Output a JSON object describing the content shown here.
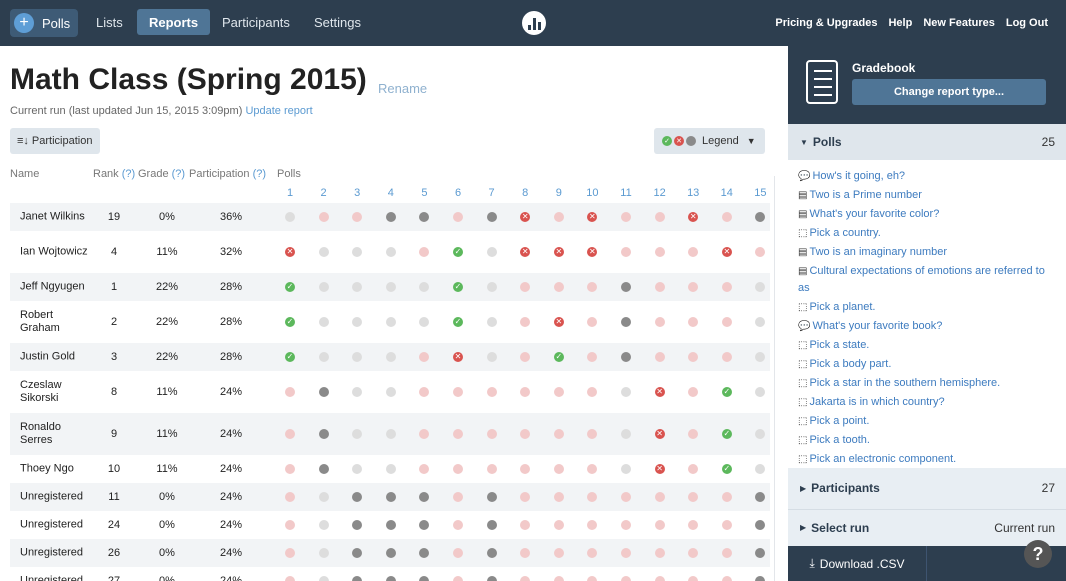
{
  "nav": {
    "polls": "Polls",
    "lists": "Lists",
    "reports": "Reports",
    "participants": "Participants",
    "settings": "Settings",
    "pricing": "Pricing & Upgrades",
    "help": "Help",
    "features": "New Features",
    "logout": "Log Out"
  },
  "page": {
    "title": "Math Class (Spring 2015)",
    "rename": "Rename",
    "subline": "Current run (last updated Jun 15, 2015 3:09pm)",
    "update": "Update report",
    "participation_btn": "Participation",
    "legend": "Legend"
  },
  "table": {
    "h_name": "Name",
    "h_rank": "Rank",
    "h_grade": "Grade",
    "h_participation": "Participation",
    "h_polls": "Polls",
    "q": "(?)",
    "poll_numbers": [
      "1",
      "2",
      "3",
      "4",
      "5",
      "6",
      "7",
      "8",
      "9",
      "10",
      "11",
      "12",
      "13",
      "14",
      "15"
    ],
    "rows": [
      {
        "name": "Janet Wilkins",
        "rank": "19",
        "grade": "0%",
        "part": "36%",
        "r": "gwwddwdxwxwwxwd"
      },
      {
        "name": "Ian Wojtowicz",
        "rank": "4",
        "grade": "11%",
        "part": "32%",
        "r": "xgggwcgxxxwwwxw"
      },
      {
        "name": "Jeff Ngyugen",
        "rank": "1",
        "grade": "22%",
        "part": "28%",
        "r": "cggggcgwwwdwwwg"
      },
      {
        "name": "Robert Graham",
        "rank": "2",
        "grade": "22%",
        "part": "28%",
        "r": "cggggcgwxwdwwwg"
      },
      {
        "name": "Justin Gold",
        "rank": "3",
        "grade": "22%",
        "part": "28%",
        "r": "cgggwxgwcwdwwwg"
      },
      {
        "name": "Czeslaw Sikorski",
        "rank": "8",
        "grade": "11%",
        "part": "24%",
        "r": "wdggwwwwwwgxwcg"
      },
      {
        "name": "Ronaldo Serres",
        "rank": "9",
        "grade": "11%",
        "part": "24%",
        "r": "wdggwwwwwwgxwcg"
      },
      {
        "name": "Thoey Ngo",
        "rank": "10",
        "grade": "11%",
        "part": "24%",
        "r": "wdggwwwwwwgxwcg"
      },
      {
        "name": "Unregistered",
        "rank": "11",
        "grade": "0%",
        "part": "24%",
        "r": "wgdddwdwwwwwwwd"
      },
      {
        "name": "Unregistered",
        "rank": "24",
        "grade": "0%",
        "part": "24%",
        "r": "wgdddwdwwwwwwwd"
      },
      {
        "name": "Unregistered",
        "rank": "26",
        "grade": "0%",
        "part": "24%",
        "r": "wgdddwdwwwwwwwd"
      },
      {
        "name": "Unregistered",
        "rank": "27",
        "grade": "0%",
        "part": "24%",
        "r": "wgdddwdwwwwwwwd"
      }
    ]
  },
  "sidebar": {
    "title": "Gradebook",
    "change": "Change report type...",
    "polls_label": "Polls",
    "polls_count": "25",
    "polls": [
      {
        "icon": "chat",
        "text": "How's it going, eh?"
      },
      {
        "icon": "list",
        "text": "Two is a Prime number"
      },
      {
        "icon": "list",
        "text": "What's your favorite color?"
      },
      {
        "icon": "click",
        "text": "Pick a country."
      },
      {
        "icon": "list",
        "text": "Two is an imaginary number"
      },
      {
        "icon": "list",
        "text": "Cultural expectations of emotions are referred to as"
      },
      {
        "icon": "click",
        "text": "Pick a planet."
      },
      {
        "icon": "chat",
        "text": "What's your favorite book?"
      },
      {
        "icon": "click",
        "text": "Pick a state."
      },
      {
        "icon": "click",
        "text": "Pick a body part."
      },
      {
        "icon": "click",
        "text": "Pick a star in the southern hemisphere."
      },
      {
        "icon": "click",
        "text": "Jakarta is in which country?"
      },
      {
        "icon": "click",
        "text": "Pick a point."
      },
      {
        "icon": "click",
        "text": "Pick a tooth."
      },
      {
        "icon": "click",
        "text": "Pick an electronic component."
      }
    ],
    "participants_label": "Participants",
    "participants_count": "27",
    "select_run": "Select run",
    "current_run": "Current run",
    "download": "Download .CSV",
    "help": "?"
  },
  "colors": {
    "correct": "#5cb85c",
    "incorrect": "#d9534f",
    "answered": "#8a8a8a",
    "not_answered": "#f2c9c9",
    "none": "#dddddd",
    "nav_bg": "#2d3e4f"
  }
}
